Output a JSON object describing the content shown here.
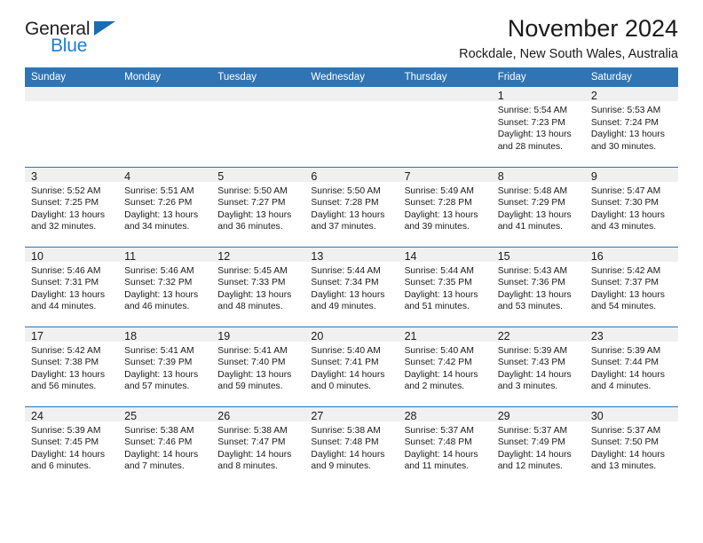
{
  "logo": {
    "text_top": "General",
    "text_bottom": "Blue",
    "triangle_icon": "triangle-icon",
    "color_dark": "#231f20",
    "color_blue": "#1b7fd4"
  },
  "header": {
    "title": "November 2024",
    "subtitle": "Rockdale, New South Wales, Australia"
  },
  "theme": {
    "header_blue": "#2f75b5",
    "daynum_bg": "#f0f0f0",
    "text": "#1a1a1a"
  },
  "weekdays": [
    "Sunday",
    "Monday",
    "Tuesday",
    "Wednesday",
    "Thursday",
    "Friday",
    "Saturday"
  ],
  "weeks": [
    [
      {
        "day": "",
        "sunrise": "",
        "sunset": "",
        "daylight_line1": "",
        "daylight_line2": ""
      },
      {
        "day": "",
        "sunrise": "",
        "sunset": "",
        "daylight_line1": "",
        "daylight_line2": ""
      },
      {
        "day": "",
        "sunrise": "",
        "sunset": "",
        "daylight_line1": "",
        "daylight_line2": ""
      },
      {
        "day": "",
        "sunrise": "",
        "sunset": "",
        "daylight_line1": "",
        "daylight_line2": ""
      },
      {
        "day": "",
        "sunrise": "",
        "sunset": "",
        "daylight_line1": "",
        "daylight_line2": ""
      },
      {
        "day": "1",
        "sunrise": "Sunrise: 5:54 AM",
        "sunset": "Sunset: 7:23 PM",
        "daylight_line1": "Daylight: 13 hours",
        "daylight_line2": "and 28 minutes."
      },
      {
        "day": "2",
        "sunrise": "Sunrise: 5:53 AM",
        "sunset": "Sunset: 7:24 PM",
        "daylight_line1": "Daylight: 13 hours",
        "daylight_line2": "and 30 minutes."
      }
    ],
    [
      {
        "day": "3",
        "sunrise": "Sunrise: 5:52 AM",
        "sunset": "Sunset: 7:25 PM",
        "daylight_line1": "Daylight: 13 hours",
        "daylight_line2": "and 32 minutes."
      },
      {
        "day": "4",
        "sunrise": "Sunrise: 5:51 AM",
        "sunset": "Sunset: 7:26 PM",
        "daylight_line1": "Daylight: 13 hours",
        "daylight_line2": "and 34 minutes."
      },
      {
        "day": "5",
        "sunrise": "Sunrise: 5:50 AM",
        "sunset": "Sunset: 7:27 PM",
        "daylight_line1": "Daylight: 13 hours",
        "daylight_line2": "and 36 minutes."
      },
      {
        "day": "6",
        "sunrise": "Sunrise: 5:50 AM",
        "sunset": "Sunset: 7:28 PM",
        "daylight_line1": "Daylight: 13 hours",
        "daylight_line2": "and 37 minutes."
      },
      {
        "day": "7",
        "sunrise": "Sunrise: 5:49 AM",
        "sunset": "Sunset: 7:28 PM",
        "daylight_line1": "Daylight: 13 hours",
        "daylight_line2": "and 39 minutes."
      },
      {
        "day": "8",
        "sunrise": "Sunrise: 5:48 AM",
        "sunset": "Sunset: 7:29 PM",
        "daylight_line1": "Daylight: 13 hours",
        "daylight_line2": "and 41 minutes."
      },
      {
        "day": "9",
        "sunrise": "Sunrise: 5:47 AM",
        "sunset": "Sunset: 7:30 PM",
        "daylight_line1": "Daylight: 13 hours",
        "daylight_line2": "and 43 minutes."
      }
    ],
    [
      {
        "day": "10",
        "sunrise": "Sunrise: 5:46 AM",
        "sunset": "Sunset: 7:31 PM",
        "daylight_line1": "Daylight: 13 hours",
        "daylight_line2": "and 44 minutes."
      },
      {
        "day": "11",
        "sunrise": "Sunrise: 5:46 AM",
        "sunset": "Sunset: 7:32 PM",
        "daylight_line1": "Daylight: 13 hours",
        "daylight_line2": "and 46 minutes."
      },
      {
        "day": "12",
        "sunrise": "Sunrise: 5:45 AM",
        "sunset": "Sunset: 7:33 PM",
        "daylight_line1": "Daylight: 13 hours",
        "daylight_line2": "and 48 minutes."
      },
      {
        "day": "13",
        "sunrise": "Sunrise: 5:44 AM",
        "sunset": "Sunset: 7:34 PM",
        "daylight_line1": "Daylight: 13 hours",
        "daylight_line2": "and 49 minutes."
      },
      {
        "day": "14",
        "sunrise": "Sunrise: 5:44 AM",
        "sunset": "Sunset: 7:35 PM",
        "daylight_line1": "Daylight: 13 hours",
        "daylight_line2": "and 51 minutes."
      },
      {
        "day": "15",
        "sunrise": "Sunrise: 5:43 AM",
        "sunset": "Sunset: 7:36 PM",
        "daylight_line1": "Daylight: 13 hours",
        "daylight_line2": "and 53 minutes."
      },
      {
        "day": "16",
        "sunrise": "Sunrise: 5:42 AM",
        "sunset": "Sunset: 7:37 PM",
        "daylight_line1": "Daylight: 13 hours",
        "daylight_line2": "and 54 minutes."
      }
    ],
    [
      {
        "day": "17",
        "sunrise": "Sunrise: 5:42 AM",
        "sunset": "Sunset: 7:38 PM",
        "daylight_line1": "Daylight: 13 hours",
        "daylight_line2": "and 56 minutes."
      },
      {
        "day": "18",
        "sunrise": "Sunrise: 5:41 AM",
        "sunset": "Sunset: 7:39 PM",
        "daylight_line1": "Daylight: 13 hours",
        "daylight_line2": "and 57 minutes."
      },
      {
        "day": "19",
        "sunrise": "Sunrise: 5:41 AM",
        "sunset": "Sunset: 7:40 PM",
        "daylight_line1": "Daylight: 13 hours",
        "daylight_line2": "and 59 minutes."
      },
      {
        "day": "20",
        "sunrise": "Sunrise: 5:40 AM",
        "sunset": "Sunset: 7:41 PM",
        "daylight_line1": "Daylight: 14 hours",
        "daylight_line2": "and 0 minutes."
      },
      {
        "day": "21",
        "sunrise": "Sunrise: 5:40 AM",
        "sunset": "Sunset: 7:42 PM",
        "daylight_line1": "Daylight: 14 hours",
        "daylight_line2": "and 2 minutes."
      },
      {
        "day": "22",
        "sunrise": "Sunrise: 5:39 AM",
        "sunset": "Sunset: 7:43 PM",
        "daylight_line1": "Daylight: 14 hours",
        "daylight_line2": "and 3 minutes."
      },
      {
        "day": "23",
        "sunrise": "Sunrise: 5:39 AM",
        "sunset": "Sunset: 7:44 PM",
        "daylight_line1": "Daylight: 14 hours",
        "daylight_line2": "and 4 minutes."
      }
    ],
    [
      {
        "day": "24",
        "sunrise": "Sunrise: 5:39 AM",
        "sunset": "Sunset: 7:45 PM",
        "daylight_line1": "Daylight: 14 hours",
        "daylight_line2": "and 6 minutes."
      },
      {
        "day": "25",
        "sunrise": "Sunrise: 5:38 AM",
        "sunset": "Sunset: 7:46 PM",
        "daylight_line1": "Daylight: 14 hours",
        "daylight_line2": "and 7 minutes."
      },
      {
        "day": "26",
        "sunrise": "Sunrise: 5:38 AM",
        "sunset": "Sunset: 7:47 PM",
        "daylight_line1": "Daylight: 14 hours",
        "daylight_line2": "and 8 minutes."
      },
      {
        "day": "27",
        "sunrise": "Sunrise: 5:38 AM",
        "sunset": "Sunset: 7:48 PM",
        "daylight_line1": "Daylight: 14 hours",
        "daylight_line2": "and 9 minutes."
      },
      {
        "day": "28",
        "sunrise": "Sunrise: 5:37 AM",
        "sunset": "Sunset: 7:48 PM",
        "daylight_line1": "Daylight: 14 hours",
        "daylight_line2": "and 11 minutes."
      },
      {
        "day": "29",
        "sunrise": "Sunrise: 5:37 AM",
        "sunset": "Sunset: 7:49 PM",
        "daylight_line1": "Daylight: 14 hours",
        "daylight_line2": "and 12 minutes."
      },
      {
        "day": "30",
        "sunrise": "Sunrise: 5:37 AM",
        "sunset": "Sunset: 7:50 PM",
        "daylight_line1": "Daylight: 14 hours",
        "daylight_line2": "and 13 minutes."
      }
    ]
  ]
}
